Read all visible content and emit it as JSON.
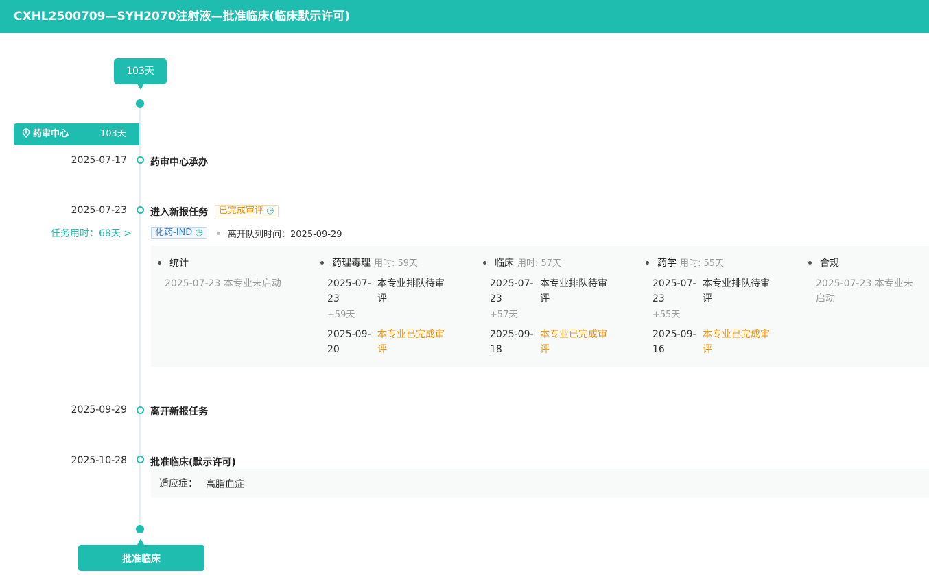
{
  "title": "CXHL2500709—SYH2070注射液—批准临床(临床默示许可)",
  "total_days": "103天",
  "center": {
    "name": "药审中心",
    "days": "103天"
  },
  "events": [
    {
      "date": "2025-07-17",
      "label": "药审中心承办"
    },
    {
      "date": "2025-07-23",
      "label": "进入新报任务",
      "status": "已完成审评",
      "task_time": "任务用时：68天 >",
      "type_tag": "化药-IND",
      "leave_label": "离开队列时间：",
      "leave_date": "2025-09-29"
    },
    {
      "date": "2025-09-29",
      "label": "离开新报任务"
    },
    {
      "date": "2025-10-28",
      "label": "批准临床(默示许可)",
      "indication_label": "适应症：",
      "indication": "高脂血症"
    }
  ],
  "disciplines": [
    {
      "name": "统计",
      "used": "",
      "start": "2025-07-23 本专业未启动"
    },
    {
      "name": "药理毒理",
      "used": "用时: 59天",
      "d1": "2025-07-23",
      "s1": "本专业排队待审评",
      "plus": "+59天",
      "d2": "2025-09-20",
      "s2": "本专业已完成审评"
    },
    {
      "name": "临床",
      "used": "用时: 57天",
      "d1": "2025-07-23",
      "s1": "本专业排队待审评",
      "plus": "+57天",
      "d2": "2025-09-18",
      "s2": "本专业已完成审评"
    },
    {
      "name": "药学",
      "used": "用时: 55天",
      "d1": "2025-07-23",
      "s1": "本专业排队待审评",
      "plus": "+55天",
      "d2": "2025-09-16",
      "s2": "本专业已完成审评"
    },
    {
      "name": "合规",
      "used": "",
      "start": "2025-07-23 本专业未启动"
    }
  ],
  "final": "批准临床",
  "colors": {
    "accent": "#1fbdb0",
    "orange": "#f0930e",
    "blue": "#3b7ddd"
  }
}
